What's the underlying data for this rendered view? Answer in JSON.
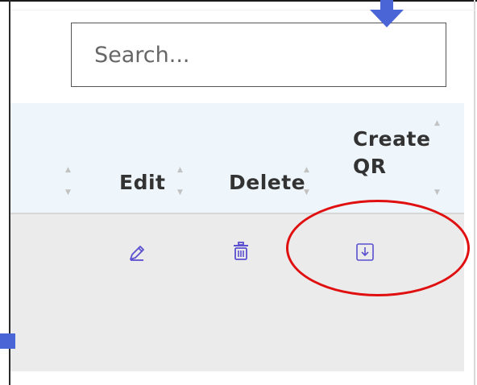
{
  "search": {
    "placeholder": "Search..."
  },
  "table": {
    "columns": [
      {
        "key": "select",
        "label": ""
      },
      {
        "key": "edit",
        "label": "Edit"
      },
      {
        "key": "delete",
        "label": "Delete"
      },
      {
        "key": "create_qr",
        "label": "Create QR"
      }
    ],
    "create_qr_line1": "Create",
    "create_qr_line2": "QR",
    "rows": [
      {
        "actions": [
          "pencil-icon",
          "trash-icon",
          "download-qr-icon"
        ]
      }
    ]
  },
  "colors": {
    "header_bg": "#eef6fb",
    "row_bg": "#ebebeb",
    "icon_accent": "#5a4fcf",
    "annotation_red": "#e01010",
    "marker_blue": "#4a66d6"
  }
}
